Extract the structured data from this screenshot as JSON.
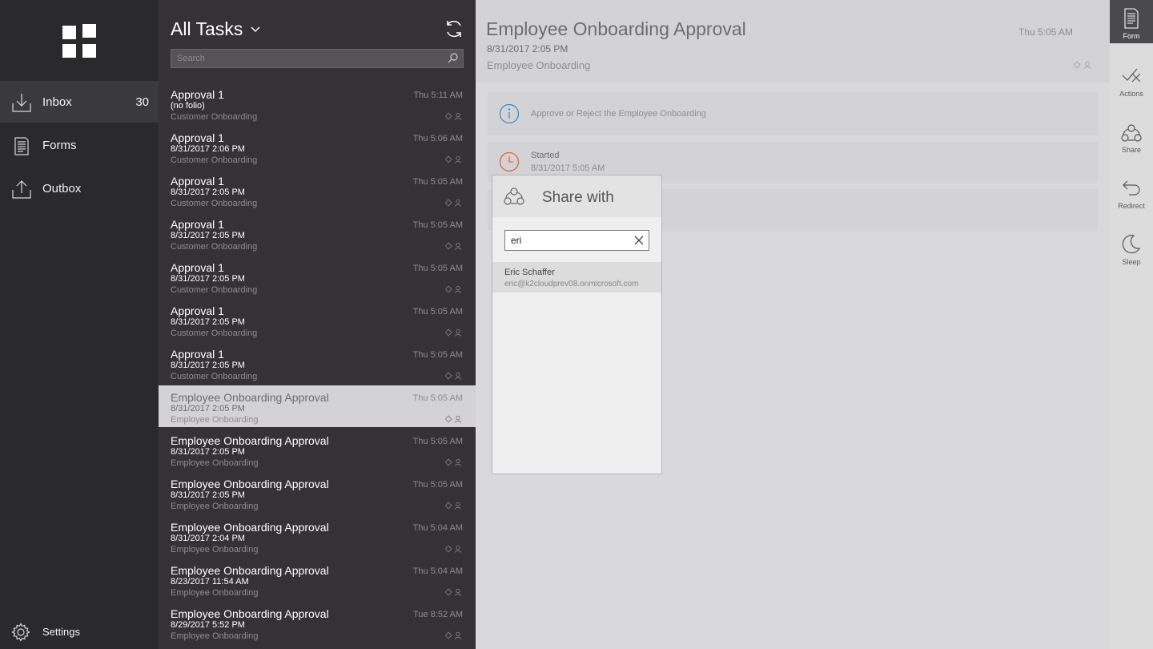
{
  "nav": {
    "items": [
      {
        "label": "Inbox",
        "count": "30",
        "icon": "inbox-icon"
      },
      {
        "label": "Forms",
        "icon": "forms-icon"
      },
      {
        "label": "Outbox",
        "icon": "outbox-icon"
      }
    ],
    "settings_label": "Settings"
  },
  "list": {
    "title": "All Tasks",
    "search_placeholder": "Search",
    "tasks": [
      {
        "title": "Approval 1",
        "date": "(no folio)",
        "category": "Customer Onboarding",
        "time": "Thu 5:11 AM"
      },
      {
        "title": "Approval 1",
        "date": "8/31/2017 2:06 PM",
        "category": "Customer Onboarding",
        "time": "Thu 5:06 AM"
      },
      {
        "title": "Approval 1",
        "date": "8/31/2017 2:05 PM",
        "category": "Customer Onboarding",
        "time": "Thu 5:05 AM"
      },
      {
        "title": "Approval 1",
        "date": "8/31/2017 2:05 PM",
        "category": "Customer Onboarding",
        "time": "Thu 5:05 AM"
      },
      {
        "title": "Approval 1",
        "date": "8/31/2017 2:05 PM",
        "category": "Customer Onboarding",
        "time": "Thu 5:05 AM"
      },
      {
        "title": "Approval 1",
        "date": "8/31/2017 2:05 PM",
        "category": "Customer Onboarding",
        "time": "Thu 5:05 AM"
      },
      {
        "title": "Approval 1",
        "date": "8/31/2017 2:05 PM",
        "category": "Customer Onboarding",
        "time": "Thu 5:05 AM"
      },
      {
        "title": "Employee Onboarding Approval",
        "date": "8/31/2017 2:05 PM",
        "category": "Employee Onboarding",
        "time": "Thu 5:05 AM"
      },
      {
        "title": "Employee Onboarding Approval",
        "date": "8/31/2017 2:05 PM",
        "category": "Employee Onboarding",
        "time": "Thu 5:05 AM"
      },
      {
        "title": "Employee Onboarding Approval",
        "date": "8/31/2017 2:05 PM",
        "category": "Employee Onboarding",
        "time": "Thu 5:05 AM"
      },
      {
        "title": "Employee Onboarding Approval",
        "date": "8/31/2017 2:04 PM",
        "category": "Employee Onboarding",
        "time": "Thu 5:04 AM"
      },
      {
        "title": "Employee Onboarding Approval",
        "date": "8/23/2017 11:54 AM",
        "category": "Employee Onboarding",
        "time": "Thu 5:04 AM"
      },
      {
        "title": "Employee Onboarding Approval",
        "date": "8/29/2017 5:52 PM",
        "category": "Employee Onboarding",
        "time": "Tue 8:52 AM"
      }
    ]
  },
  "detail": {
    "title": "Employee Onboarding Approval",
    "date": "8/31/2017 2:05 PM",
    "category": "Employee Onboarding",
    "time": "Thu 5:05 AM",
    "info_text": "Approve or Reject the Employee Onboarding",
    "status_label": "Started",
    "status_date": "8/31/2017 5:05 AM"
  },
  "share": {
    "title": "Share with",
    "query": "eri",
    "result_name": "Eric Schaffer",
    "result_email": "eric@k2cloudprev08.onmicrosoft.com"
  },
  "rail": {
    "items": [
      {
        "label": "Form",
        "icon": "form-icon"
      },
      {
        "label": "Actions",
        "icon": "actions-icon"
      },
      {
        "label": "Share",
        "icon": "share-icon"
      },
      {
        "label": "Redirect",
        "icon": "redirect-icon"
      },
      {
        "label": "Sleep",
        "icon": "sleep-icon"
      }
    ]
  },
  "colors": {
    "nav_bg": "#2a2a2c",
    "list_bg": "#343236",
    "info_accent": "#3f84c1",
    "started_accent": "#e06a3a"
  }
}
